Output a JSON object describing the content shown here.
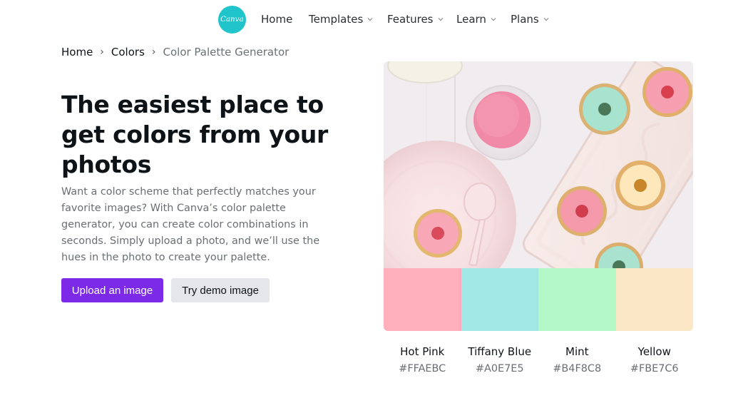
{
  "nav": {
    "logo_text": "Canva",
    "items": [
      {
        "label": "Home",
        "has_dropdown": false
      },
      {
        "label": "Templates",
        "has_dropdown": true
      },
      {
        "label": "Features",
        "has_dropdown": true
      },
      {
        "label": "Learn",
        "has_dropdown": true
      },
      {
        "label": "Plans",
        "has_dropdown": true
      }
    ]
  },
  "breadcrumb": {
    "items": [
      "Home",
      "Colors",
      "Color Palette Generator"
    ]
  },
  "hero": {
    "headline": "The easiest place to get colors from your photos",
    "description": "Want a color scheme that perfectly matches your favorite images? With Canva’s color palette generator, you can create color combinations in seconds. Simply upload a photo, and we’ll use the hues in the photo to create your palette.",
    "upload_button": "Upload an image",
    "demo_button": "Try demo image"
  },
  "palette": [
    {
      "name": "Hot Pink",
      "hex": "#FFAEBC"
    },
    {
      "name": "Tiffany Blue",
      "hex": "#A0E7E5"
    },
    {
      "name": "Mint",
      "hex": "#B4F8C8"
    },
    {
      "name": "Yellow",
      "hex": "#FBE7C6"
    }
  ],
  "icons": {
    "breadcrumb_separator": "chevron-right-icon",
    "dropdown": "chevron-down-icon"
  }
}
